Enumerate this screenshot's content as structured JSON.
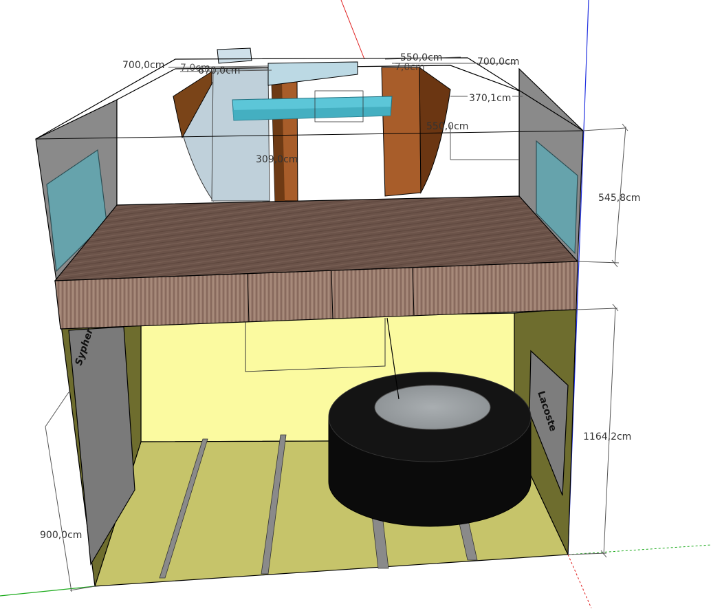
{
  "model_view": {
    "dimensions": {
      "top_left_width": "700,0cm",
      "top_right_width": "700,0cm",
      "top_center_width": "550,0cm",
      "top_inner_width": "670,0cm",
      "top_offset_a": "7,0cm",
      "top_offset_b": "7,0cm",
      "right_depth": "370,1cm",
      "center_span": "550,0cm",
      "center_height": "309,0cm",
      "upper_height": "545,8cm",
      "lower_height": "1164,2cm",
      "left_depth": "900,0cm"
    },
    "colors": {
      "floor": "#c6c46a",
      "back_wall": "#fbfaa0",
      "side_wall": "#6e6d2e",
      "mezzanine_top": "#6b5349",
      "mezzanine_fascia": "#9a7c6e",
      "glass": "#66a3ac",
      "shelf_blue": "#5cc6d8",
      "wood": "#a85d2a",
      "pedestal": "#0b0b0b",
      "pedestal_top": "#9ea3a6",
      "axis_red": "#e02020",
      "axis_green": "#1aaa1a",
      "axis_blue": "#2030e0"
    }
  }
}
